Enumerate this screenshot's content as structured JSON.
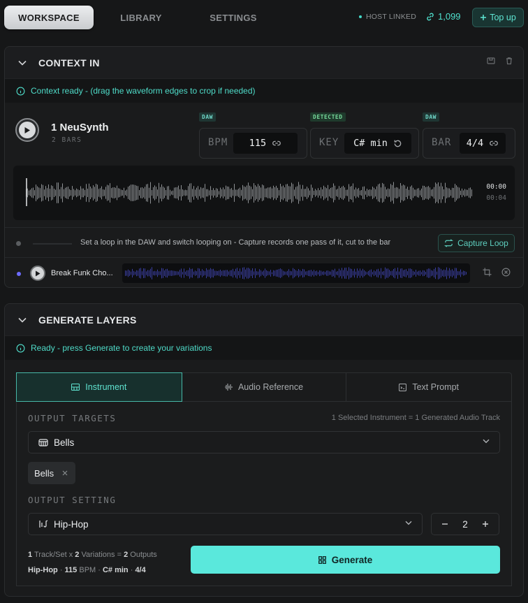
{
  "nav": {
    "tabs": [
      "WORKSPACE",
      "LIBRARY",
      "SETTINGS"
    ],
    "host_status": "HOST LINKED",
    "credits": "1,099",
    "topup_label": "Top up"
  },
  "context": {
    "title": "CONTEXT IN",
    "info": "Context ready - (drag the waveform edges to crop if needed)",
    "track_name": "1 NeuSynth",
    "track_bars": "2 BARS",
    "bpm": {
      "tag": "DAW",
      "label": "BPM",
      "value": "115"
    },
    "key": {
      "tag": "DETECTED",
      "label": "KEY",
      "value": "C# min"
    },
    "bar": {
      "tag": "DAW",
      "label": "BAR",
      "value": "4/4"
    },
    "time_current": "00:00",
    "time_total": "00:04",
    "loop_text": "Set a loop in the DAW and switch looping on - Capture records one pass of it, cut to the bar",
    "capture_label": "Capture Loop",
    "ref_name": "Break Funk Cho..."
  },
  "generate": {
    "title": "GENERATE LAYERS",
    "info": "Ready - press Generate to create your variations",
    "tabs": [
      "Instrument",
      "Audio Reference",
      "Text Prompt"
    ],
    "output_targets_label": "OUTPUT TARGETS",
    "output_targets_note": "1 Selected Instrument = 1 Generated Audio Track",
    "instrument_value": "Bells",
    "chip_label": "Bells",
    "output_setting_label": "OUTPUT SETTING",
    "genre_value": "Hip-Hop",
    "variations": "2",
    "summary": {
      "tracks": "1",
      "tracks_text": " Track/Set x ",
      "variations": "2",
      "variations_text": " Variations = ",
      "outputs": "2",
      "outputs_text": " Outputs",
      "genre": "Hip-Hop",
      "sep1": " · ",
      "bpm": "115",
      "bpm_unit": " BPM · ",
      "key": "C# min",
      "sep2": " · ",
      "meter": "4/4"
    },
    "generate_label": "Generate"
  },
  "colors": {
    "accent": "#5ae8dc",
    "accent_text": "#4fdcc9",
    "background": "#161718"
  }
}
